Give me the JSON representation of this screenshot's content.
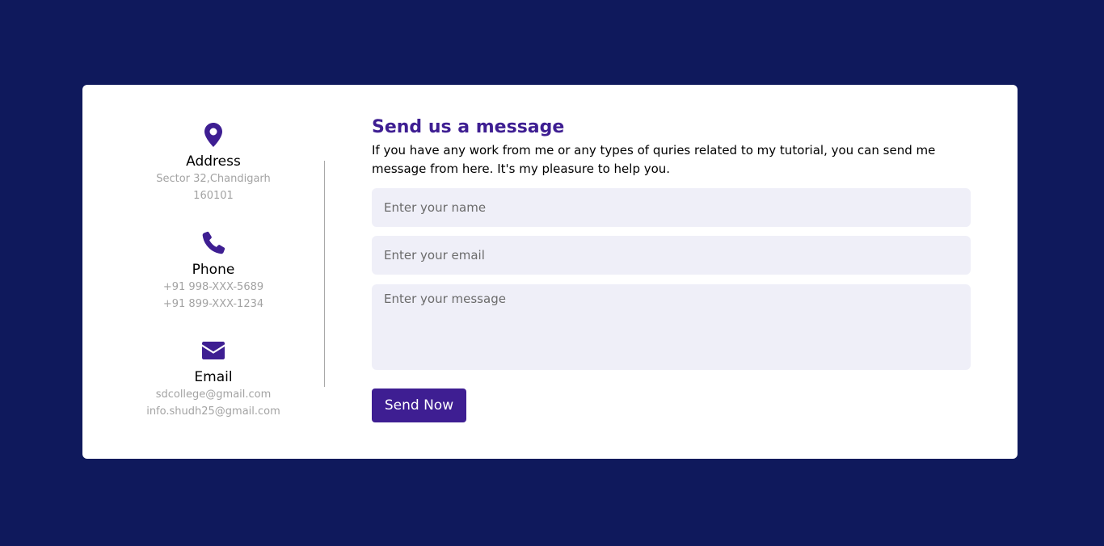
{
  "colors": {
    "background": "#0f195c",
    "card": "#ffffff",
    "accent": "#3e1e92",
    "field_bg": "#efeff8",
    "muted_text": "#a3a3a3"
  },
  "contact_info": {
    "address": {
      "icon": "map-pin-icon",
      "title": "Address",
      "lines": [
        "Sector 32,Chandigarh",
        "160101"
      ]
    },
    "phone": {
      "icon": "phone-icon",
      "title": "Phone",
      "lines": [
        "+91 998-XXX-5689",
        "+91 899-XXX-1234"
      ]
    },
    "email": {
      "icon": "envelope-icon",
      "title": "Email",
      "lines": [
        "sdcollege@gmail.com",
        "info.shudh25@gmail.com"
      ]
    }
  },
  "form": {
    "title": "Send us a message",
    "description": "If you have any work from me or any types of quries related to my tutorial, you can send me message from here. It's my pleasure to help you.",
    "name_placeholder": "Enter your name",
    "email_placeholder": "Enter your email",
    "message_placeholder": "Enter your message",
    "submit_label": "Send Now"
  }
}
